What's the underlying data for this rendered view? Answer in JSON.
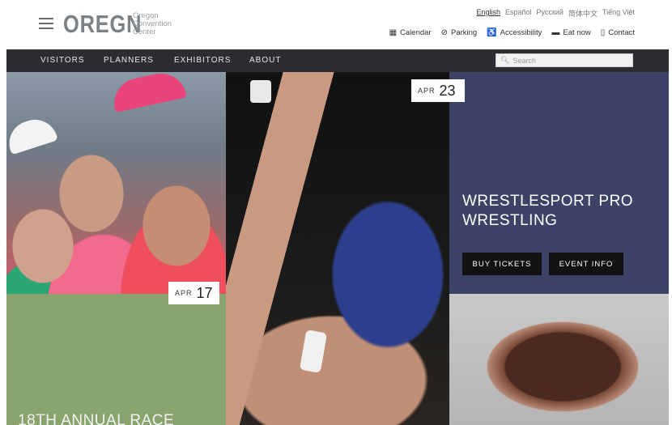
{
  "header": {
    "logo_word": "OREGN",
    "logo_subtitle": [
      "Oregon",
      "Convention",
      "Center"
    ],
    "languages": [
      {
        "label": "English",
        "active": true
      },
      {
        "label": "Español",
        "active": false
      },
      {
        "label": "Русский",
        "active": false
      },
      {
        "label": "简体中文",
        "active": false
      },
      {
        "label": "Tiếng Việt",
        "active": false
      }
    ],
    "utility": [
      {
        "icon": "calendar-icon",
        "glyph": "▦",
        "label": "Calendar"
      },
      {
        "icon": "parking-icon",
        "glyph": "⊘",
        "label": "Parking"
      },
      {
        "icon": "accessibility-icon",
        "glyph": "♿",
        "label": "Accessibility"
      },
      {
        "icon": "eat-now-icon",
        "glyph": "▬",
        "label": "Eat now"
      },
      {
        "icon": "contact-icon",
        "glyph": "▯",
        "label": "Contact"
      }
    ]
  },
  "nav": {
    "items": [
      "VISITORS",
      "PLANNERS",
      "EXHIBITORS",
      "ABOUT"
    ],
    "search_placeholder": "Search"
  },
  "events": {
    "featured": {
      "date_month": "APR",
      "date_day": "23",
      "title": "WRESTLESPORT PRO WRESTLING",
      "buy_label": "BUY TICKETS",
      "info_label": "EVENT INFO"
    },
    "second": {
      "date_month": "APR",
      "date_day": "17",
      "title": "18TH ANNUAL RACE"
    }
  },
  "colors": {
    "nav_bg": "#2b2d32",
    "event_panel": "#3c4367",
    "race_panel": "#8aa46d",
    "button_bg": "#121212"
  }
}
